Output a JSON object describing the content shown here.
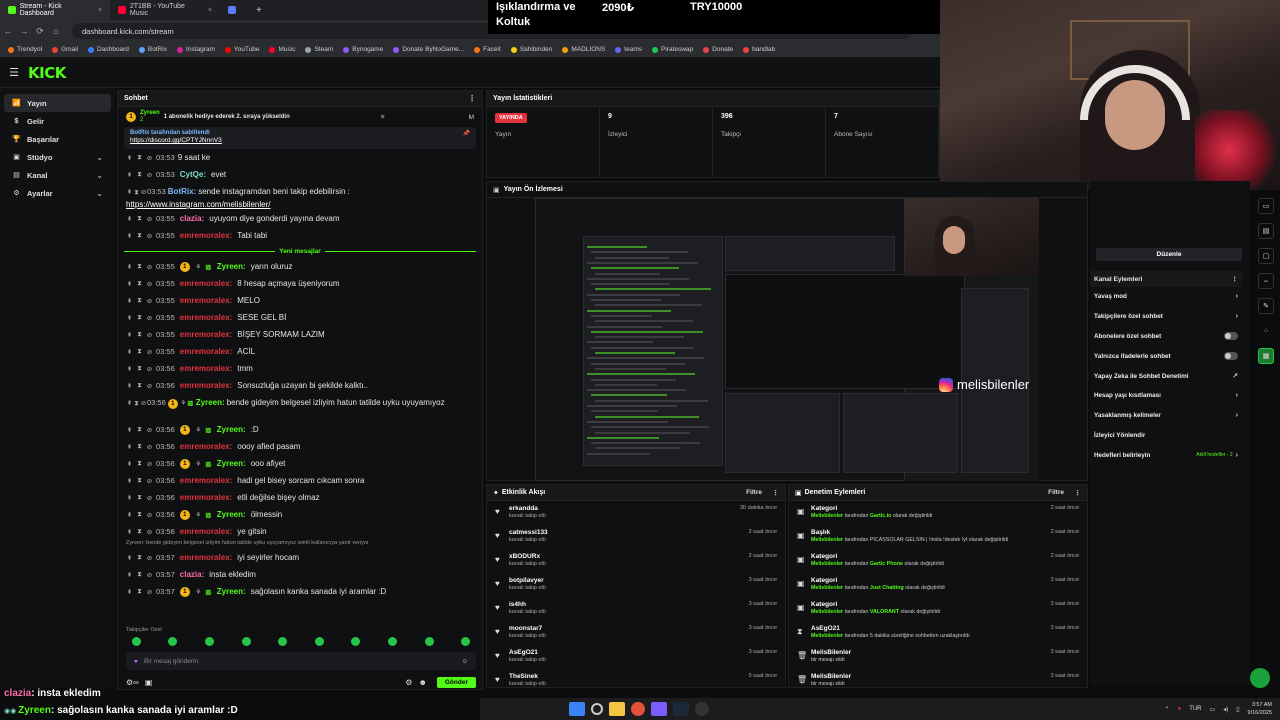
{
  "browser": {
    "tabs": [
      {
        "label": "Stream - Kick Dashboard",
        "color": "#53fc18",
        "active": true
      },
      {
        "label": "2T1BB - YouTube Music",
        "color": "#ff0033",
        "active": false
      },
      {
        "label": "",
        "color": "#5c7cfa",
        "active": false
      }
    ],
    "new_tab": "+",
    "url": "dashboard.kick.com/stream",
    "bookmarks": [
      {
        "label": "Trendyol",
        "color": "#f27a1a"
      },
      {
        "label": "Gmail",
        "color": "#ea4335"
      },
      {
        "label": "Dashboard",
        "color": "#3b82f6"
      },
      {
        "label": "BotRix",
        "color": "#60a5fa"
      },
      {
        "label": "Instagram",
        "color": "#d6249f"
      },
      {
        "label": "YouTube",
        "color": "#ff0000"
      },
      {
        "label": "Music",
        "color": "#ff0033"
      },
      {
        "label": "Steam",
        "color": "#9ca3af"
      },
      {
        "label": "Bynogame",
        "color": "#8b5cf6"
      },
      {
        "label": "Donate ByNoGame...",
        "color": "#8b5cf6"
      },
      {
        "label": "Faceit",
        "color": "#f97316"
      },
      {
        "label": "Sahibinden",
        "color": "#facc15"
      },
      {
        "label": "MADLIONS",
        "color": "#f59e0b"
      },
      {
        "label": "teams",
        "color": "#6366f1"
      },
      {
        "label": "Pirateswap",
        "color": "#22c55e"
      },
      {
        "label": "Donate",
        "color": "#ef4444"
      },
      {
        "label": "bandlab",
        "color": "#ef4444"
      }
    ]
  },
  "overlay": {
    "goal_line1": "Işıklandırma ve",
    "goal_line2": "Koltuk",
    "goal_current": "2090₺",
    "goal_target": "TRY10000"
  },
  "sidebar": {
    "items": [
      {
        "label": "Yayın",
        "icon": "📶",
        "active": true,
        "expand": false
      },
      {
        "label": "Gelir",
        "icon": "$",
        "active": false,
        "expand": false
      },
      {
        "label": "Başarılar",
        "icon": "🏆",
        "active": false,
        "expand": false
      },
      {
        "label": "Stüdyo",
        "icon": "▣",
        "active": false,
        "expand": true
      },
      {
        "label": "Kanal",
        "icon": "▤",
        "active": false,
        "expand": true
      },
      {
        "label": "Ayarlar",
        "icon": "⚙",
        "active": false,
        "expand": true
      }
    ]
  },
  "chat": {
    "title": "Sohbet",
    "sub_user": "Zyreen",
    "sub_count": "2",
    "sub_text": "1 abonelik hediye ederek 2. sıraya yükseldin",
    "pinned_by": "BotRix tarafından sabitlendi",
    "pinned_link": "https://discord.gg/CPTYJNnnV3",
    "new_messages": "Yeni mesajlar",
    "messages": [
      {
        "time": "03:53",
        "user": "",
        "text": "9 saat ke",
        "color": "u-green",
        "badge": "",
        "two": false
      },
      {
        "time": "03:53",
        "user": "CytQe:",
        "text": "evet",
        "color": "u-cyan",
        "badge": "",
        "two": false
      },
      {
        "time": "03:53",
        "user": "BotRix:",
        "text": "sende instagramdan beni takip edebilirsin :",
        "color": "u-blue",
        "badge": "",
        "two": true,
        "link": "https://www.instagram.com/melisbilenler/"
      },
      {
        "time": "03:55",
        "user": "clazia:",
        "text": "uyuyom diye gonderdi yayına devam",
        "color": "u-pink",
        "badge": "",
        "two": false
      },
      {
        "time": "03:55",
        "user": "emremoralex:",
        "text": "Tabi tabi",
        "color": "u-red",
        "badge": "",
        "two": false
      },
      {
        "time": "03:55",
        "user": "Zyreen:",
        "text": "yarın oluruz",
        "color": "u-green",
        "badge": "1",
        "two": false,
        "sep_before": true
      },
      {
        "time": "03:55",
        "user": "emremoralex:",
        "text": "8 hesap açmaya üşeniyorum",
        "color": "u-red",
        "badge": "",
        "two": false
      },
      {
        "time": "03:55",
        "user": "emremoralex:",
        "text": "MELO",
        "color": "u-red",
        "badge": "",
        "two": false
      },
      {
        "time": "03:55",
        "user": "emremoralex:",
        "text": "SESE GEL Bİ",
        "color": "u-red",
        "badge": "",
        "two": false
      },
      {
        "time": "03:55",
        "user": "emremoralex:",
        "text": "BİŞEY SORMAM LAZIM",
        "color": "u-red",
        "badge": "",
        "two": false
      },
      {
        "time": "03:55",
        "user": "emremoralex:",
        "text": "ACİL",
        "color": "u-red",
        "badge": "",
        "two": false
      },
      {
        "time": "03:56",
        "user": "emremoralex:",
        "text": "tmm",
        "color": "u-red",
        "badge": "",
        "two": false
      },
      {
        "time": "03:56",
        "user": "emremoralex:",
        "text": "Sonsuzluğa uzayan bi şekilde kalktı..",
        "color": "u-red",
        "badge": "",
        "two": false
      },
      {
        "time": "03:56",
        "user": "Zyreen:",
        "text": "bende gideyim belgesel izliyim hatun tatilde uyku uyuyamıyoz",
        "color": "u-green",
        "badge": "1",
        "two": true
      },
      {
        "time": "03:56",
        "user": "Zyreen:",
        "text": ":D",
        "color": "u-green",
        "badge": "1",
        "two": false
      },
      {
        "time": "03:56",
        "user": "emremoralex:",
        "text": "oooy afied pasam",
        "color": "u-red",
        "badge": "",
        "two": false
      },
      {
        "time": "03:56",
        "user": "Zyreen:",
        "text": "ooo afiyet",
        "color": "u-green",
        "badge": "1",
        "two": false
      },
      {
        "time": "03:56",
        "user": "emremoralex:",
        "text": "hadi gel bisey sorcam cıkcam sonra",
        "color": "u-red",
        "badge": "",
        "two": false
      },
      {
        "time": "03:56",
        "user": "emremoralex:",
        "text": "etli değilse bişey olmaz",
        "color": "u-red",
        "badge": "",
        "two": false
      },
      {
        "time": "03:56",
        "user": "Zyreen:",
        "text": "ölmessin",
        "color": "u-green",
        "badge": "1",
        "two": false
      },
      {
        "time": "03:56",
        "user": "emremoralex:",
        "text": "ye gitsin",
        "color": "u-red",
        "badge": "",
        "two": false
      },
      {
        "time": "03:57",
        "user": "emremoralex:",
        "text": "iyi seyirler hocam",
        "color": "u-red",
        "badge": "",
        "two": false,
        "reply": "Zyreen: bende gideyim belgesel izliyim hatun tatilde uyku uyuyamıyoz isimli kullanıcıya yanıt veriyor"
      },
      {
        "time": "03:57",
        "user": "clazia:",
        "text": "insta ekledim",
        "color": "u-pink",
        "badge": "",
        "two": false
      },
      {
        "time": "03:57",
        "user": "Zyreen:",
        "text": "sağolasın kanka sanada iyi aramlar :D",
        "color": "u-green",
        "badge": "1",
        "two": false
      }
    ],
    "takip_label": "Takipçiler Özel",
    "input_placeholder": "Bir mesaj gönderin",
    "send_label": "Gönder"
  },
  "stats": {
    "title": "Yayın İstatistikleri",
    "items": [
      {
        "value": "YAYINDA",
        "label": "Yayın",
        "live": true
      },
      {
        "value": "9",
        "label": "İzleyici",
        "live": false
      },
      {
        "value": "396",
        "label": "Takipçi",
        "live": false
      },
      {
        "value": "7",
        "label": "Abone Sayısı",
        "live": false
      }
    ]
  },
  "preview": {
    "title": "Yayın Ön İzlemesi",
    "streamer": "melisbilenler"
  },
  "channel": {
    "edit_label": "Düzenle",
    "title": "Kanal Eylemleri",
    "items": [
      {
        "label": "Yavaş mod",
        "kind": "arrow"
      },
      {
        "label": "Takipçilere özel sohbet",
        "kind": "arrow"
      },
      {
        "label": "Abonelere özel sohbet",
        "kind": "toggle"
      },
      {
        "label": "Yalnızca ifadelerle sohbet",
        "kind": "toggle"
      },
      {
        "label": "Yapay Zeka ile Sohbet Denetimi",
        "kind": "ext"
      },
      {
        "label": "Hesap yaşı kısıtlaması",
        "kind": "arrow"
      },
      {
        "label": "Yasaklanmış kelimeler",
        "kind": "arrow"
      },
      {
        "label": "İzleyici Yönlendir",
        "kind": "none"
      },
      {
        "label": "Hedefleri belirleyin",
        "kind": "goal",
        "extra": "Aktif hedefler - 2"
      }
    ]
  },
  "activity": {
    "title": "Etkinlik Akışı",
    "filter": "Filtre",
    "rows": [
      {
        "name": "erkandda",
        "desc": "kanalı takip etti",
        "time": "30 dakika önce"
      },
      {
        "name": "catmessi133",
        "desc": "kanalı takip etti",
        "time": "2 saat önce"
      },
      {
        "name": "xBODURx",
        "desc": "kanalı takip etti",
        "time": "2 saat önce"
      },
      {
        "name": "botpilavyer",
        "desc": "kanalı takip etti",
        "time": "3 saat önce"
      },
      {
        "name": "is4hh",
        "desc": "kanalı takip etti",
        "time": "3 saat önce"
      },
      {
        "name": "moonstar7",
        "desc": "kanalı takip etti",
        "time": "3 saat önce"
      },
      {
        "name": "AsEgO21",
        "desc": "kanalı takip etti",
        "time": "3 saat önce"
      },
      {
        "name": "TheSinek",
        "desc": "kanalı takip etti",
        "time": "5 saat önce"
      }
    ]
  },
  "moderation": {
    "title": "Denetim Eylemleri",
    "filter": "Filtre",
    "rows": [
      {
        "name": "Kategori",
        "actor": "Melisbilenler",
        "mid": "tarafından",
        "value": "Gartic.io",
        "end": "olarak değiştirildi",
        "time": "2 saat önce",
        "icon": "▣"
      },
      {
        "name": "Başlık",
        "actor": "Melisbilenler",
        "mid": "tarafından PİCASSOLAR GELSİN | !insta !destek !yt",
        "value": "",
        "end": "olarak değiştirildi",
        "time": "2 saat önce",
        "icon": "▣"
      },
      {
        "name": "Kategori",
        "actor": "Melisbilenler",
        "mid": "tarafından",
        "value": "Gartic Phone",
        "end": "olarak değiştirildi",
        "time": "2 saat önce",
        "icon": "▣"
      },
      {
        "name": "Kategori",
        "actor": "Melisbilenler",
        "mid": "tarafından",
        "value": "Just Chatting",
        "end": "olarak değiştirildi",
        "time": "3 saat önce",
        "icon": "▣"
      },
      {
        "name": "Kategori",
        "actor": "Melisbilenler",
        "mid": "tarafından",
        "value": "VALORANT",
        "end": "olarak değiştirildi",
        "time": "3 saat önce",
        "icon": "▣"
      },
      {
        "name": "AsEgO21",
        "actor": "Melisbilenler",
        "mid": "tarafından 5 dakika süreliğine sohbetten uzaklaştırıldı",
        "value": "",
        "end": "",
        "time": "3 saat önce",
        "icon": "⧗"
      },
      {
        "name": "MelisBilenler",
        "actor": "",
        "mid": "bir mesajı sildi",
        "value": "",
        "end": "",
        "time": "3 saat önce",
        "icon": "🗑"
      },
      {
        "name": "MelisBilenler",
        "actor": "",
        "mid": "bir mesajı sildi",
        "value": "",
        "end": "",
        "time": "3 saat önce",
        "icon": "🗑"
      }
    ]
  },
  "bottom_overlay": {
    "line1_user": "clazia",
    "line1_text": ": insta ekledim",
    "line2_user": "Zyreen",
    "line2_text": ": sağolasın kanka sanada iyi aramlar :D"
  },
  "taskbar": {
    "lang": "TUR",
    "time": "3:57 AM",
    "date": "9/16/2025"
  }
}
